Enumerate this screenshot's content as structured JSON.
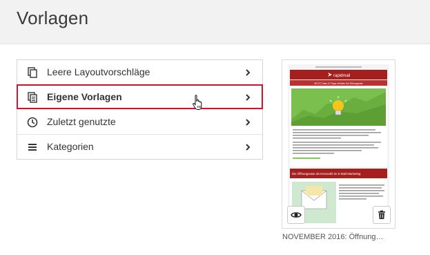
{
  "header": {
    "title": "Vorlagen"
  },
  "menu": {
    "items": [
      {
        "label": "Leere Layoutvorschläge",
        "icon": "document-copy-icon"
      },
      {
        "label": "Eigene Vorlagen",
        "icon": "document-lines-icon",
        "selected": true
      },
      {
        "label": "Zuletzt genutzte",
        "icon": "clock-icon"
      },
      {
        "label": "Kategorien",
        "icon": "list-icon"
      }
    ]
  },
  "template_card": {
    "caption": "NOVEMBER 2016: Öffnung…",
    "preview": {
      "brand": "rapidmail",
      "banner": "#FLFC Dass 10 Tipps erhöhen Ihe Öffnungsrate",
      "section_heading": "Die Öffnungsrate als Kennzahl im E-Mail Marketing"
    }
  },
  "colors": {
    "accent": "#d0112b",
    "preview_red": "#a51f1f",
    "preview_green": "#7bbf4f"
  }
}
